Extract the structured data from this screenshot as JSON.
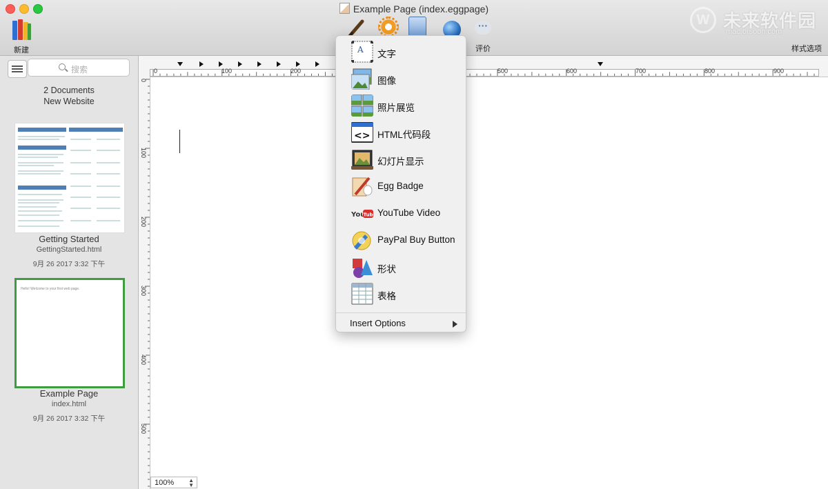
{
  "window": {
    "title": "Example Page (index.eggpage)"
  },
  "toolbar": {
    "new_label": "新建",
    "rating_label": "评价",
    "style_label": "样式选项",
    "more_glyph": "···"
  },
  "watermark": {
    "text": "未来软件园",
    "url": "mac.orsoon.com",
    "mark": "W"
  },
  "sidebar": {
    "search_placeholder": "搜索",
    "doc_count": "2 Documents",
    "site_name": "New Website",
    "documents": [
      {
        "name": "Getting Started",
        "file": "GettingStarted.html",
        "date": "9月 26 2017 3:32 下午"
      },
      {
        "name": "Example Page",
        "file": "index.html",
        "date": "9月 26 2017 3:32 下午",
        "preview_text": "Hello!  Welcome to your first web page."
      }
    ]
  },
  "ruler": {
    "h_labels": [
      "0",
      "100",
      "200",
      "500",
      "600",
      "700",
      "800",
      "900"
    ],
    "v_labels": [
      "0",
      "100",
      "200",
      "300",
      "400",
      "500"
    ]
  },
  "canvas": {
    "zoom": "100%"
  },
  "insert_menu": {
    "items": [
      {
        "label": "文字",
        "icon": "text-box-icon"
      },
      {
        "label": "图像",
        "icon": "image-icon"
      },
      {
        "label": "照片展览",
        "icon": "photo-gallery-icon"
      },
      {
        "label": "HTML代码段",
        "icon": "html-snippet-icon"
      },
      {
        "label": "幻灯片显示",
        "icon": "slideshow-icon"
      },
      {
        "label": "Egg Badge",
        "icon": "egg-badge-icon"
      },
      {
        "label": "YouTube Video",
        "icon": "youtube-icon"
      },
      {
        "label": "PayPal Buy Button",
        "icon": "paypal-icon"
      },
      {
        "label": "形状",
        "icon": "shapes-icon"
      },
      {
        "label": "表格",
        "icon": "table-icon"
      }
    ],
    "options_label": "Insert Options"
  }
}
